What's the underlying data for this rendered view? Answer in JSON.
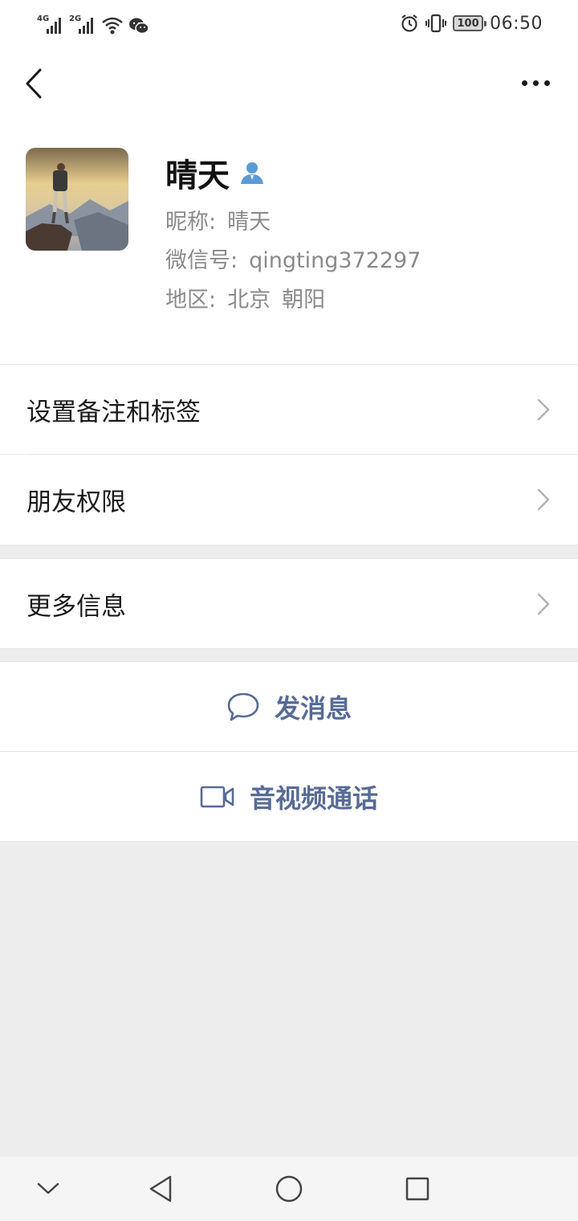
{
  "status_bar": {
    "network_1": "4G",
    "network_2": "2G",
    "battery": "100",
    "time": "06:50",
    "icons": [
      "signal-4g-icon",
      "signal-2g-icon",
      "wifi-icon",
      "wechat-icon",
      "alarm-icon",
      "vibrate-icon",
      "battery-icon"
    ]
  },
  "nav": {
    "back_icon": "chevron-left-icon",
    "more_icon": "more-dots-icon"
  },
  "profile": {
    "name": "晴天",
    "nickname_label": "昵称:",
    "nickname": "晴天",
    "wechat_id_label": "微信号:",
    "wechat_id": "qingting372297",
    "region_label": "地区:",
    "region_city": "北京",
    "region_district": "朝阳",
    "badge_color": "#5b9bd5"
  },
  "cells": {
    "remark_tags": "设置备注和标签",
    "friend_permissions": "朋友权限",
    "more_info": "更多信息"
  },
  "actions": {
    "send_message": "发消息",
    "video_call": "音视频通话",
    "color": "#576b95"
  }
}
